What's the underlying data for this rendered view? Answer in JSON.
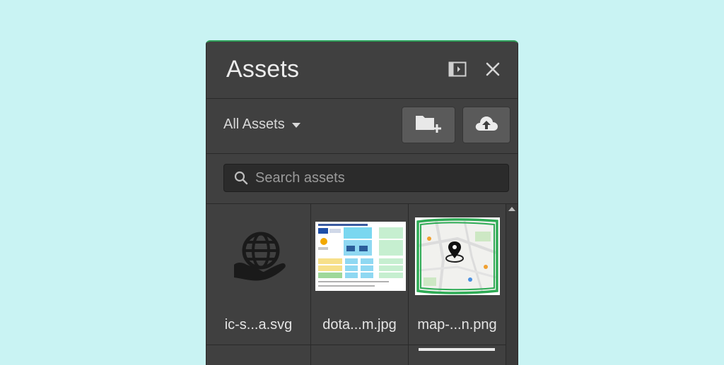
{
  "panel": {
    "title": "Assets",
    "accent_color": "#2e9e57",
    "header_icons": [
      "sidebar-toggle-icon",
      "close-icon"
    ]
  },
  "toolbar": {
    "filter_label": "All Assets",
    "filter_icon": "caret-down-icon",
    "new_folder_icon": "folder-plus-icon",
    "upload_icon": "cloud-upload-icon"
  },
  "search": {
    "placeholder": "Search assets",
    "value": "",
    "icon": "search-icon"
  },
  "assets": [
    {
      "filename": "ic-s...a.svg",
      "thumb": "globe-hand-icon"
    },
    {
      "filename": "dota...m.jpg",
      "thumb": "document-thumbnail"
    },
    {
      "filename": "map-...n.png",
      "thumb": "map-thumbnail"
    }
  ]
}
